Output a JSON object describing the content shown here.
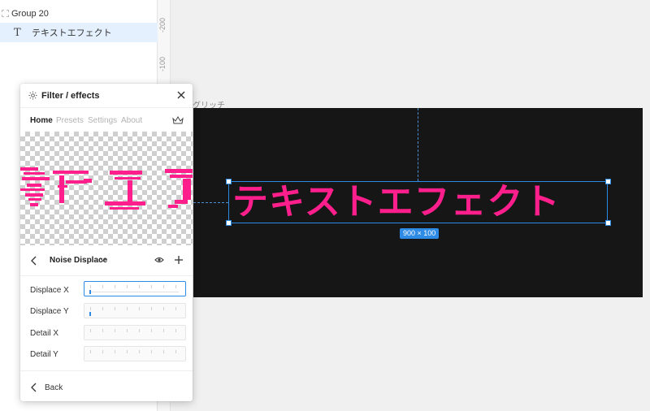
{
  "layers": {
    "group_label": "Group 20",
    "text_layer_label": "テキストエフェクト",
    "text_glyph": "T"
  },
  "ruler": {
    "marks": [
      "-200",
      "-100"
    ]
  },
  "canvas": {
    "frame_label": "グリッチ",
    "headline": "テキストエフェクト",
    "size_badge": "900 × 100",
    "text_color": "#ff1f8c",
    "selection_color": "#2d8ae5"
  },
  "panel": {
    "title": "Filter / effects",
    "tabs": [
      "Home",
      "Presets",
      "Settings",
      "About"
    ],
    "active_tab": "Home",
    "effect_name": "Noise Displace",
    "params": [
      {
        "label": "Displace X"
      },
      {
        "label": "Displace Y"
      },
      {
        "label": "Detail X"
      },
      {
        "label": "Detail Y"
      }
    ],
    "back_label": "Back",
    "icons": [
      "sun-icon",
      "close-icon",
      "crown-icon",
      "chevron-left-icon",
      "chevron-down-icon",
      "eye-icon",
      "plus-icon"
    ]
  }
}
